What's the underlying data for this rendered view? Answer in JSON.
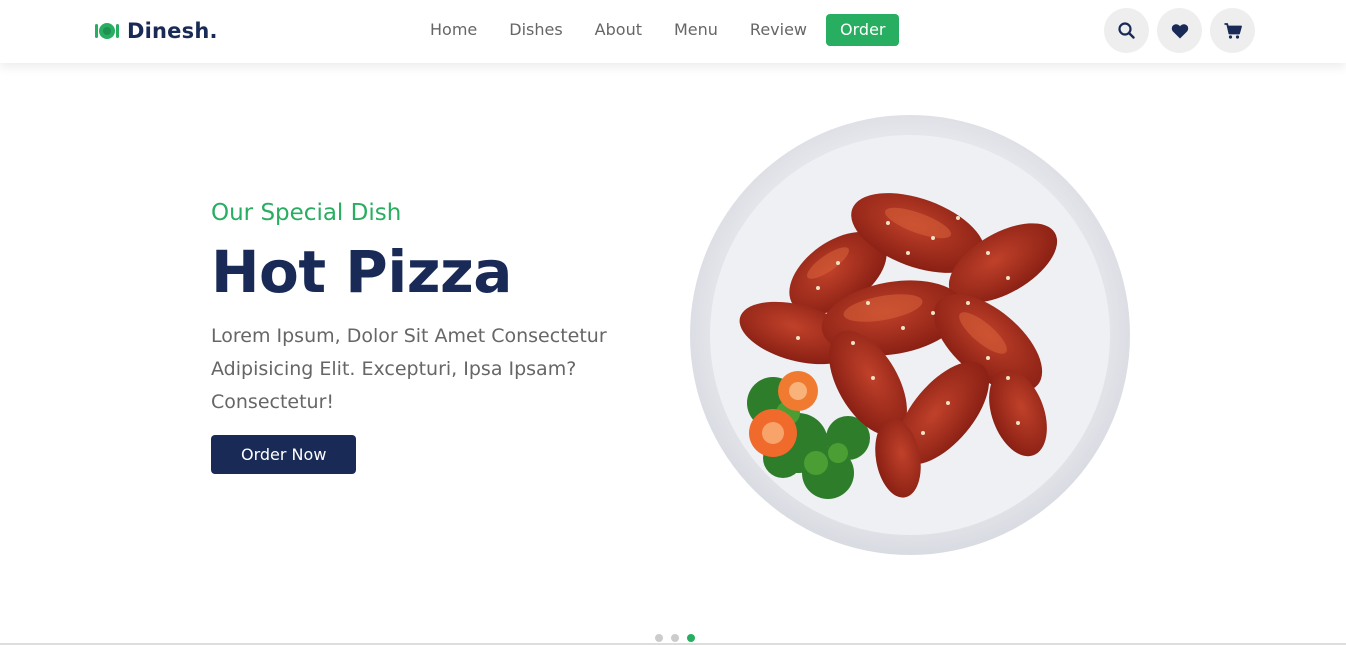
{
  "brand": {
    "name": "Dinesh.",
    "icon": "utensils-icon",
    "accent_color": "#27ae60",
    "dark_color": "#192a56"
  },
  "nav": {
    "links": [
      "Home",
      "Dishes",
      "About",
      "Menu",
      "Review"
    ],
    "order_label": "Order"
  },
  "header_icons": [
    "search-icon",
    "heart-icon",
    "cart-icon"
  ],
  "hero": {
    "subtitle": "Our Special Dish",
    "title": "Hot Pizza",
    "description": "Lorem Ipsum, Dolor Sit Amet Consectetur Adipisicing Elit. Excepturi, Ipsa Ipsam? Consectetur!",
    "button_label": "Order Now"
  },
  "slider": {
    "slide_count": 3,
    "active_slide": 3
  }
}
